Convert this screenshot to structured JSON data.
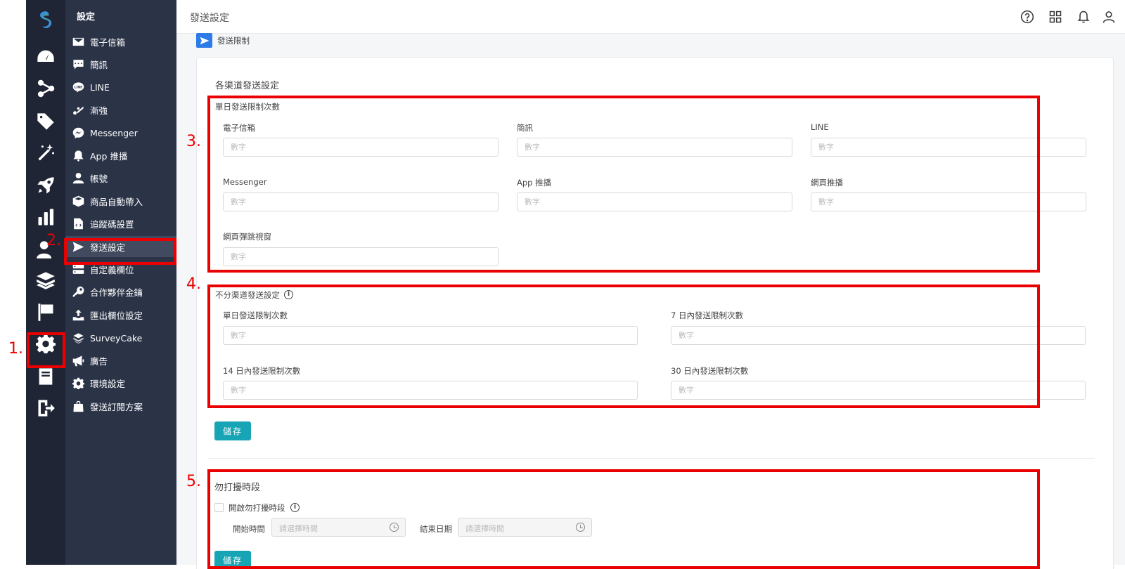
{
  "header": {
    "title": "發送設定"
  },
  "rail": {
    "icons": [
      "logo-icon",
      "dashboard-gauge-icon",
      "share-nodes-icon",
      "tag-icon",
      "magic-wand-icon",
      "rocket-icon",
      "bar-chart-icon",
      "users-icon",
      "layers-icon",
      "flag-icon",
      "gear-icon",
      "book-icon",
      "logout-icon"
    ]
  },
  "menu": {
    "title": "設定",
    "items": [
      {
        "label": "電子信箱",
        "icon": "envelope-icon"
      },
      {
        "label": "簡訊",
        "icon": "chat-icon"
      },
      {
        "label": "LINE",
        "icon": "line-icon"
      },
      {
        "label": "漸強",
        "icon": "crescendo-icon"
      },
      {
        "label": "Messenger",
        "icon": "messenger-icon"
      },
      {
        "label": "App 推播",
        "icon": "bell-icon"
      },
      {
        "label": "帳號",
        "icon": "user-icon"
      },
      {
        "label": "商品自動帶入",
        "icon": "box-icon"
      },
      {
        "label": "追蹤碼設置",
        "icon": "code-file-icon"
      },
      {
        "label": "發送設定",
        "icon": "paper-plane-icon"
      },
      {
        "label": "自定義欄位",
        "icon": "server-icon"
      },
      {
        "label": "合作夥伴金鑰",
        "icon": "key-icon"
      },
      {
        "label": "匯出欄位設定",
        "icon": "export-icon"
      },
      {
        "label": "SurveyCake",
        "icon": "surveycake-icon"
      },
      {
        "label": "廣告",
        "icon": "megaphone-icon"
      },
      {
        "label": "環境設定",
        "icon": "cog-icon"
      },
      {
        "label": "發送訂閱方案",
        "icon": "shopping-bag-icon"
      }
    ]
  },
  "breadcrumb": {
    "label": "發送限制"
  },
  "channel_settings": {
    "title": "各渠道發送設定",
    "daily_limit": {
      "title": "單日發送限制次數",
      "fields": [
        {
          "label": "電子信箱",
          "placeholder": "數字"
        },
        {
          "label": "簡訊",
          "placeholder": "數字"
        },
        {
          "label": "LINE",
          "placeholder": "數字"
        },
        {
          "label": "Messenger",
          "placeholder": "數字"
        },
        {
          "label": "App 推播",
          "placeholder": "數字"
        },
        {
          "label": "網頁推播",
          "placeholder": "數字"
        },
        {
          "label": "網頁彈跳視窗",
          "placeholder": "數字"
        }
      ]
    },
    "global": {
      "title": "不分渠道發送設定",
      "fields": [
        {
          "label": "單日發送限制次數",
          "placeholder": "數字"
        },
        {
          "label": "7 日內發送限制次數",
          "placeholder": "數字"
        },
        {
          "label": "14 日內發送限制次數",
          "placeholder": "數字"
        },
        {
          "label": "30 日內發送限制次數",
          "placeholder": "數字"
        }
      ]
    },
    "save_label": "儲存"
  },
  "dnd": {
    "title": "勿打擾時段",
    "enable_label": "開啟勿打擾時段",
    "enabled": false,
    "start_label": "開始時間",
    "start_placeholder": "請選擇時間",
    "end_label": "結束日期",
    "end_placeholder": "請選擇時間",
    "save_label": "儲存"
  },
  "annotations": [
    "1.",
    "2.",
    "3.",
    "4.",
    "5."
  ],
  "colors": {
    "accent": "#17a5b6",
    "annotation": "#ea0000",
    "rail_bg": "#1f2534",
    "menu_bg": "#2b3347"
  }
}
